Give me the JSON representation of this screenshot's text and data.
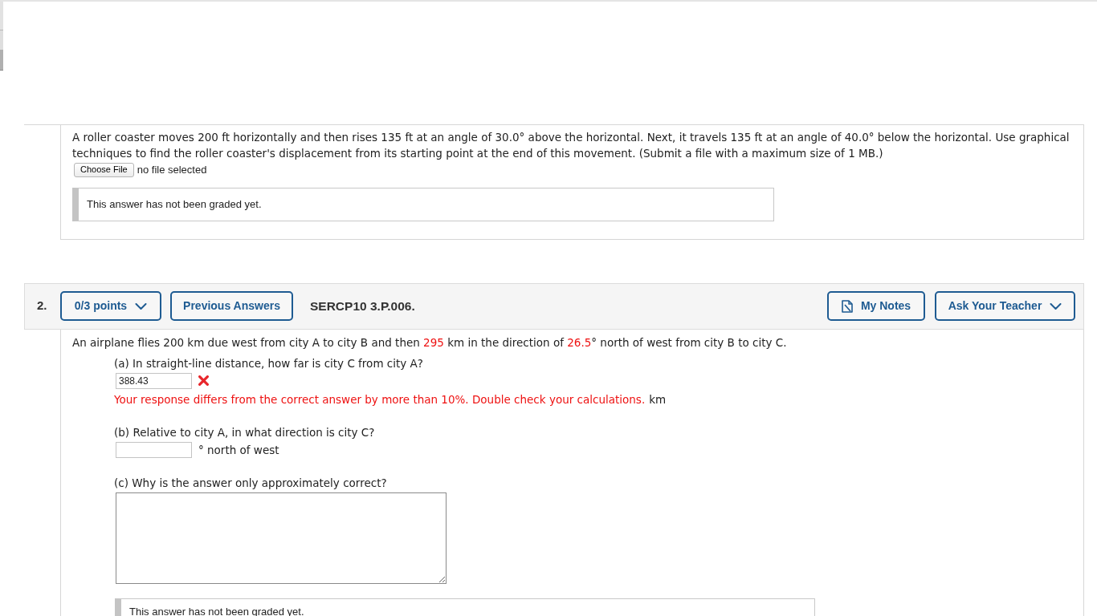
{
  "question_1": {
    "prompt": "A roller coaster moves 200 ft horizontally and then rises 135 ft at an angle of 30.0° above the horizontal. Next, it travels 135 ft at an angle of 40.0° below the horizontal. Use graphical techniques to find the roller coaster's displacement from its starting point at the end of this movement. (Submit a file with a maximum size of 1 MB.)",
    "file_upload": {
      "button": "Choose File",
      "status": "no file selected"
    },
    "grading_note": "This answer has not been graded yet."
  },
  "question_2": {
    "number": "2.",
    "points": "0/3 points",
    "previous_answers": "Previous Answers",
    "code": "SERCP10 3.P.006.",
    "my_notes": "My Notes",
    "ask_teacher": "Ask Your Teacher",
    "prompt": [
      {
        "kind": "text",
        "text": "An airplane flies 200 km due west from city A to city B and then "
      },
      {
        "kind": "given",
        "text": "295"
      },
      {
        "kind": "text",
        "text": " km in the direction of "
      },
      {
        "kind": "given",
        "text": "26.5"
      },
      {
        "kind": "text",
        "text": "° north of west from city B to city C."
      }
    ],
    "parts": [
      {
        "kind": "numeric",
        "label": "(a) In straight-line distance, how far is city C from city A?",
        "value": "388.43",
        "correct": false,
        "feedback": "Your response differs from the correct answer by more than 10%. Double check your calculations.",
        "unit": "km"
      },
      {
        "kind": "numeric",
        "label": "(b) Relative to city A, in what direction is city C?",
        "unit": "° north of west"
      },
      {
        "kind": "essay",
        "label": "(c) Why is the answer only approximately correct?"
      }
    ],
    "grading_note": "This answer has not been graded yet."
  }
}
